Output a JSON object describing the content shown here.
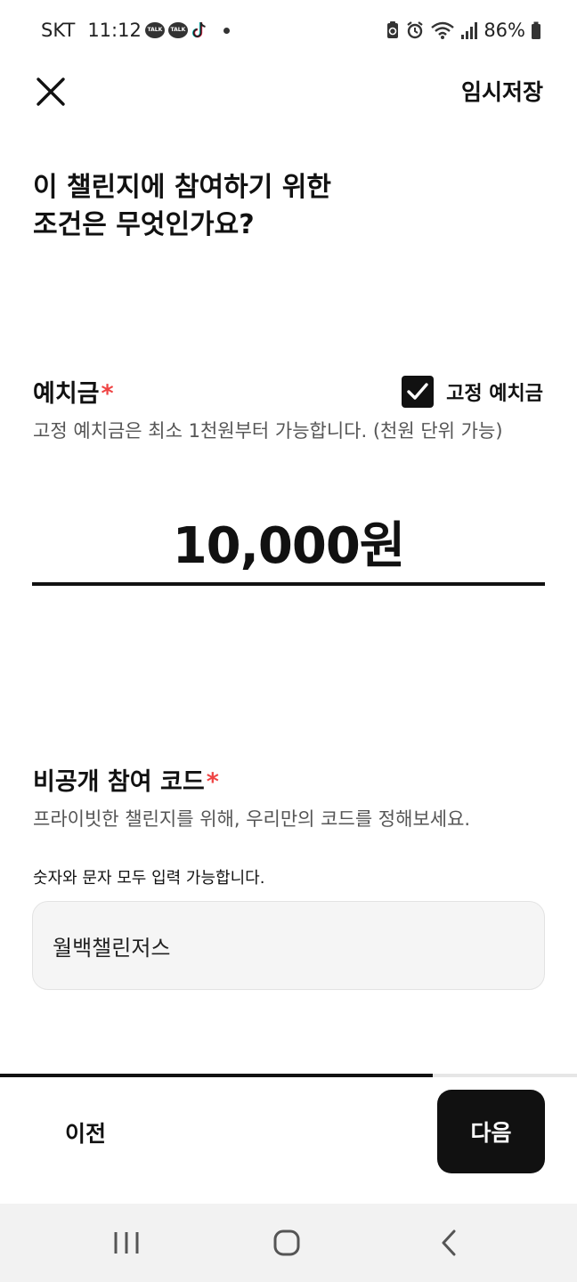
{
  "status_bar": {
    "carrier": "SKT",
    "time": "11:12",
    "talk_badge": "TALK",
    "battery": "86%"
  },
  "header": {
    "save_draft_label": "임시저장"
  },
  "question": "이 챌린지에 참여하기 위한\n조건은 무엇인가요?",
  "deposit": {
    "title": "예치금",
    "required_mark": "*",
    "fixed_label": "고정 예치금",
    "fixed_checked": true,
    "description": "고정 예치금은 최소 1천원부터 가능합니다. (천원 단위 가능)",
    "amount": "10,000원"
  },
  "private_code": {
    "title": "비공개 참여 코드",
    "required_mark": "*",
    "description": "프라이빗한 챌린지를 위해, 우리만의 코드를 정해보세요.",
    "hint": "숫자와 문자 모두 입력 가능합니다.",
    "value": "월백챌린저스"
  },
  "progress": {
    "fraction": 0.75
  },
  "footer": {
    "prev_label": "이전",
    "next_label": "다음"
  },
  "colors": {
    "accent": "#111111",
    "required": "#ef4444",
    "input_bg": "#f5f5f5",
    "nav_bg": "#f2f2f2"
  }
}
